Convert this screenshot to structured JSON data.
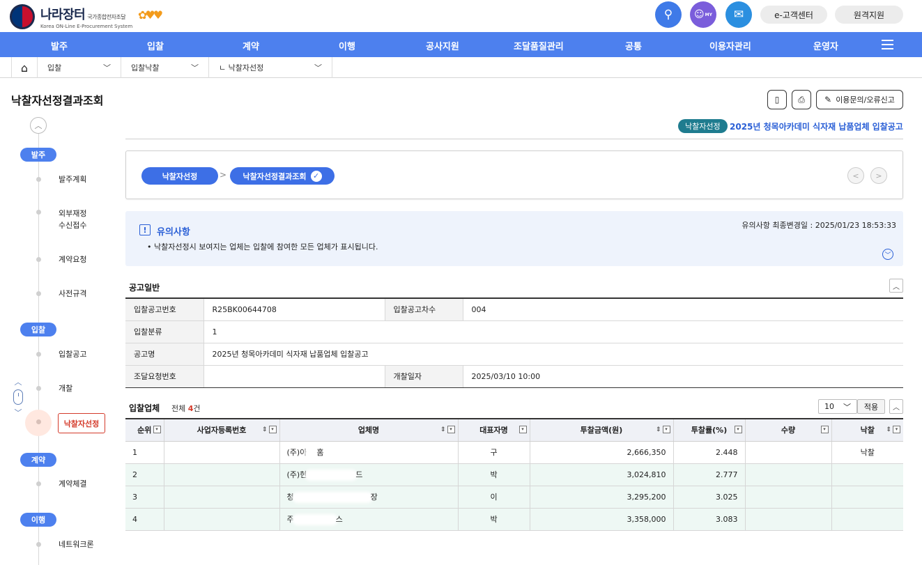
{
  "header": {
    "logo_title": "나라장터",
    "logo_title_sub": "국가종합전자조달",
    "logo_subtitle": "Korea ON-Line E-Procurement System",
    "my_label": "MY",
    "customer_center": "e-고객센터",
    "remote_support": "원격지원"
  },
  "nav": {
    "items": [
      "발주",
      "입찰",
      "계약",
      "이행",
      "공사지원",
      "조달품질관리",
      "공통",
      "이용자관리",
      "운영자"
    ]
  },
  "breadcrumb": {
    "level1": "입찰",
    "level2": "입찰낙찰",
    "level3": "ㄴ 낙찰자선정"
  },
  "page": {
    "title": "낙찰자선정결과조회",
    "report_button": "이용문의/오류신고",
    "stage_badge": "낙찰자선정",
    "notice_title": "2025년 청목아카데미 식자재 납품업체 입찰공고"
  },
  "sidebar": {
    "categories": {
      "order": "발주",
      "bid": "입찰",
      "contract": "계약",
      "perform": "이행"
    },
    "items": {
      "order_plan": "발주계획",
      "outside_1": "외부재정",
      "outside_2": "수신접수",
      "contract_request": "계약요청",
      "pre_spec": "사전규격",
      "bid_notice": "입찰공고",
      "opening": "개찰",
      "winner_select": "낙찰자선정",
      "contract_sign": "계약체결",
      "network": "네트워크론"
    }
  },
  "steps": {
    "step1": "낙찰자선정",
    "step2": "낙찰자선정결과조회"
  },
  "caution": {
    "title": "유의사항",
    "updated": "유의사항 최종변경일 : 2025/01/23 18:53:33",
    "text": "• 낙찰자선정시 보여지는 업체는 입찰에 참여한 모든 업체가 표시됩니다."
  },
  "general": {
    "section_title": "공고일반",
    "labels": {
      "bid_no": "입찰공고번호",
      "bid_seq": "입찰공고차수",
      "bid_class": "입찰분류",
      "notice_name": "공고명",
      "request_no": "조달요청번호",
      "opening_date": "개찰일자"
    },
    "values": {
      "bid_no": "R25BK00644708",
      "bid_seq": "004",
      "bid_class": "1",
      "notice_name": "2025년 청목아카데미 식자재 납품업체 입찰공고",
      "request_no": "",
      "opening_date": "2025/03/10 10:00"
    }
  },
  "bidders": {
    "section_title": "입찰업체",
    "count_prefix": "전체",
    "count": "4",
    "count_suffix": "건",
    "page_size": "10",
    "apply": "적용",
    "columns": [
      "순위",
      "사업자등록번호",
      "업체명",
      "대표자명",
      "투찰금액(원)",
      "투찰률(%)",
      "수량",
      "낙찰"
    ],
    "rows": [
      {
        "rank": "1",
        "bizno": "",
        "company_a": "(주)아",
        "company_b": "홈",
        "rep": "구",
        "amount": "2,666,350",
        "rate": "2.448",
        "qty": "",
        "award": "낙찰"
      },
      {
        "rank": "2",
        "bizno": "",
        "company_a": "(주)현",
        "company_b": "드",
        "rep": "박",
        "amount": "3,024,810",
        "rate": "2.777",
        "qty": "",
        "award": ""
      },
      {
        "rank": "3",
        "bizno": "",
        "company_a": "청",
        "company_b": "장",
        "rep": "이",
        "amount": "3,295,200",
        "rate": "3.025",
        "qty": "",
        "award": ""
      },
      {
        "rank": "4",
        "bizno": "",
        "company_a": "주",
        "company_b": "스",
        "rep": "박",
        "amount": "3,358,000",
        "rate": "3.083",
        "qty": "",
        "award": ""
      }
    ]
  }
}
